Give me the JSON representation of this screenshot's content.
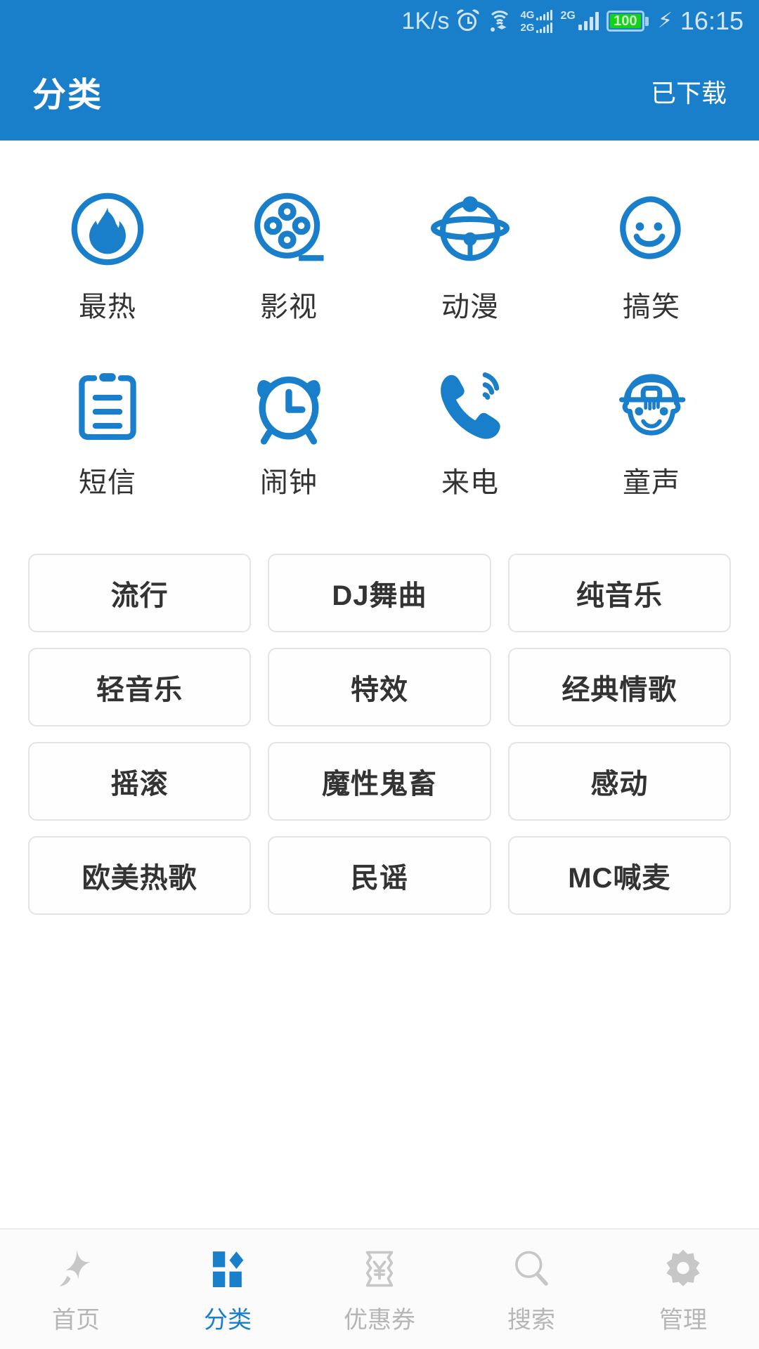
{
  "statusbar": {
    "network_speed": "1K/s",
    "alarm_icon": "alarm-icon",
    "wifi_icon": "wifi-icon",
    "sim1_label_top": "4G",
    "sim1_label_bottom": "2G",
    "sim2_label": "2G",
    "battery_percent": "100",
    "charging_icon": "charging-bolt-icon",
    "time": "16:15",
    "bar_color": "#1A7FCB",
    "text_color": "#CFE4F5",
    "battery_fill_color": "#15D215"
  },
  "header": {
    "title": "分类",
    "action_label": "已下载",
    "background": "#1A7FCB",
    "text_color": "#FFFFFF"
  },
  "categories": {
    "accent_color": "#1A7FCB",
    "items": [
      {
        "label": "最热",
        "icon": "flame-circle-icon"
      },
      {
        "label": "影视",
        "icon": "film-reel-icon"
      },
      {
        "label": "动漫",
        "icon": "anime-bell-icon"
      },
      {
        "label": "搞笑",
        "icon": "smiley-face-icon"
      },
      {
        "label": "短信",
        "icon": "clipboard-message-icon"
      },
      {
        "label": "闹钟",
        "icon": "alarm-clock-icon"
      },
      {
        "label": "来电",
        "icon": "ringing-phone-icon"
      },
      {
        "label": "童声",
        "icon": "child-face-icon"
      }
    ]
  },
  "tags": {
    "border_color": "#E4E4E4",
    "text_color": "#333333",
    "items": [
      "流行",
      "DJ舞曲",
      "纯音乐",
      "轻音乐",
      "特效",
      "经典情歌",
      "摇滚",
      "魔性鬼畜",
      "感动",
      "欧美热歌",
      "民谣",
      "MC喊麦"
    ]
  },
  "bottom_nav": {
    "active_color": "#1A7FCB",
    "inactive_color": "#B6B6B6",
    "items": [
      {
        "label": "首页",
        "icon": "star-shooting-icon",
        "active": false
      },
      {
        "label": "分类",
        "icon": "grid-category-icon",
        "active": true
      },
      {
        "label": "优惠券",
        "icon": "coupon-yen-icon",
        "active": false
      },
      {
        "label": "搜索",
        "icon": "search-magnifier-icon",
        "active": false
      },
      {
        "label": "管理",
        "icon": "gear-settings-icon",
        "active": false
      }
    ]
  }
}
